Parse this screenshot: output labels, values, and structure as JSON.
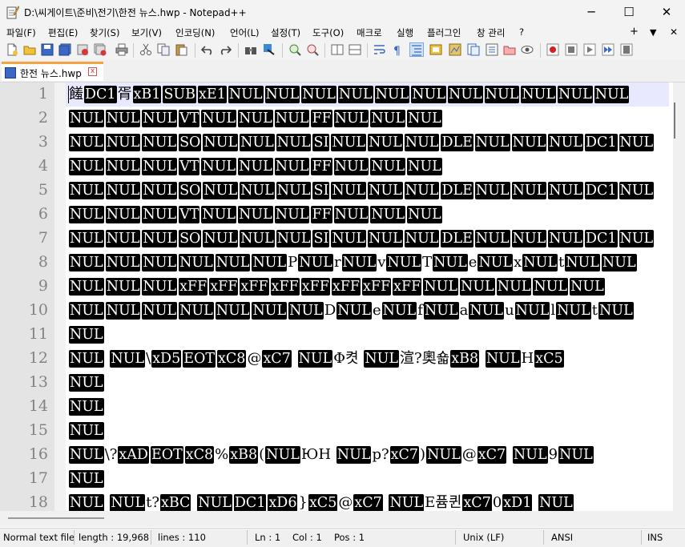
{
  "window": {
    "title": "D:\\씨게이트\\준비\\전기\\한전 뉴스.hwp - Notepad++",
    "minimize": "─",
    "maximize": "☐",
    "close": "✕"
  },
  "menu": {
    "items": [
      "파일(F)",
      "편집(E)",
      "찾기(S)",
      "보기(V)",
      "인코딩(N)",
      "언어(L)",
      "설정(T)",
      "도구(O)",
      "매크로",
      "실행",
      "플러그인",
      "창 관리",
      "?"
    ],
    "plus": "+",
    "down": "▼",
    "close": "✕"
  },
  "tab": {
    "label": "한전 뉴스.hwp",
    "close": "x"
  },
  "editor": {
    "line_numbers": [
      "1",
      "2",
      "3",
      "4",
      "5",
      "6",
      "7",
      "8",
      "9",
      "10",
      "11",
      "12",
      "13",
      "14",
      "15",
      "16",
      "17",
      "18"
    ],
    "lines": [
      [
        [
          "t",
          "饈"
        ],
        [
          "c",
          "DC1"
        ],
        [
          "t",
          "胥"
        ],
        [
          "c",
          "xB1"
        ],
        [
          "c",
          "SUB"
        ],
        [
          "c",
          "xE1"
        ],
        [
          "c",
          "NUL"
        ],
        [
          "c",
          "NUL"
        ],
        [
          "c",
          "NUL"
        ],
        [
          "c",
          "NUL"
        ],
        [
          "c",
          "NUL"
        ],
        [
          "c",
          "NUL"
        ],
        [
          "c",
          "NUL"
        ],
        [
          "c",
          "NUL"
        ],
        [
          "c",
          "NUL"
        ],
        [
          "c",
          "NUL"
        ],
        [
          "c",
          "NUL"
        ]
      ],
      [
        [
          "c",
          "NUL"
        ],
        [
          "c",
          "NUL"
        ],
        [
          "c",
          "NUL"
        ],
        [
          "c",
          "VT"
        ],
        [
          "c",
          "NUL"
        ],
        [
          "c",
          "NUL"
        ],
        [
          "c",
          "NUL"
        ],
        [
          "c",
          "FF"
        ],
        [
          "c",
          "NUL"
        ],
        [
          "c",
          "NUL"
        ],
        [
          "c",
          "NUL"
        ]
      ],
      [
        [
          "c",
          "NUL"
        ],
        [
          "c",
          "NUL"
        ],
        [
          "c",
          "NUL"
        ],
        [
          "c",
          "SO"
        ],
        [
          "c",
          "NUL"
        ],
        [
          "c",
          "NUL"
        ],
        [
          "c",
          "NUL"
        ],
        [
          "c",
          "SI"
        ],
        [
          "c",
          "NUL"
        ],
        [
          "c",
          "NUL"
        ],
        [
          "c",
          "NUL"
        ],
        [
          "c",
          "DLE"
        ],
        [
          "c",
          "NUL"
        ],
        [
          "c",
          "NUL"
        ],
        [
          "c",
          "NUL"
        ],
        [
          "c",
          "DC1"
        ],
        [
          "c",
          "NUL"
        ]
      ],
      [
        [
          "c",
          "NUL"
        ],
        [
          "c",
          "NUL"
        ],
        [
          "c",
          "NUL"
        ],
        [
          "c",
          "VT"
        ],
        [
          "c",
          "NUL"
        ],
        [
          "c",
          "NUL"
        ],
        [
          "c",
          "NUL"
        ],
        [
          "c",
          "FF"
        ],
        [
          "c",
          "NUL"
        ],
        [
          "c",
          "NUL"
        ],
        [
          "c",
          "NUL"
        ]
      ],
      [
        [
          "c",
          "NUL"
        ],
        [
          "c",
          "NUL"
        ],
        [
          "c",
          "NUL"
        ],
        [
          "c",
          "SO"
        ],
        [
          "c",
          "NUL"
        ],
        [
          "c",
          "NUL"
        ],
        [
          "c",
          "NUL"
        ],
        [
          "c",
          "SI"
        ],
        [
          "c",
          "NUL"
        ],
        [
          "c",
          "NUL"
        ],
        [
          "c",
          "NUL"
        ],
        [
          "c",
          "DLE"
        ],
        [
          "c",
          "NUL"
        ],
        [
          "c",
          "NUL"
        ],
        [
          "c",
          "NUL"
        ],
        [
          "c",
          "DC1"
        ],
        [
          "c",
          "NUL"
        ]
      ],
      [
        [
          "c",
          "NUL"
        ],
        [
          "c",
          "NUL"
        ],
        [
          "c",
          "NUL"
        ],
        [
          "c",
          "VT"
        ],
        [
          "c",
          "NUL"
        ],
        [
          "c",
          "NUL"
        ],
        [
          "c",
          "NUL"
        ],
        [
          "c",
          "FF"
        ],
        [
          "c",
          "NUL"
        ],
        [
          "c",
          "NUL"
        ],
        [
          "c",
          "NUL"
        ]
      ],
      [
        [
          "c",
          "NUL"
        ],
        [
          "c",
          "NUL"
        ],
        [
          "c",
          "NUL"
        ],
        [
          "c",
          "SO"
        ],
        [
          "c",
          "NUL"
        ],
        [
          "c",
          "NUL"
        ],
        [
          "c",
          "NUL"
        ],
        [
          "c",
          "SI"
        ],
        [
          "c",
          "NUL"
        ],
        [
          "c",
          "NUL"
        ],
        [
          "c",
          "NUL"
        ],
        [
          "c",
          "DLE"
        ],
        [
          "c",
          "NUL"
        ],
        [
          "c",
          "NUL"
        ],
        [
          "c",
          "NUL"
        ],
        [
          "c",
          "DC1"
        ],
        [
          "c",
          "NUL"
        ]
      ],
      [
        [
          "c",
          "NUL"
        ],
        [
          "c",
          "NUL"
        ],
        [
          "c",
          "NUL"
        ],
        [
          "c",
          "NUL"
        ],
        [
          "c",
          "NUL"
        ],
        [
          "c",
          "NUL"
        ],
        [
          "t",
          "P"
        ],
        [
          "c",
          "NUL"
        ],
        [
          "t",
          "r"
        ],
        [
          "c",
          "NUL"
        ],
        [
          "t",
          "v"
        ],
        [
          "c",
          "NUL"
        ],
        [
          "t",
          "T"
        ],
        [
          "c",
          "NUL"
        ],
        [
          "t",
          "e"
        ],
        [
          "c",
          "NUL"
        ],
        [
          "t",
          "x"
        ],
        [
          "c",
          "NUL"
        ],
        [
          "t",
          "t"
        ],
        [
          "c",
          "NUL"
        ],
        [
          "c",
          "NUL"
        ]
      ],
      [
        [
          "c",
          "NUL"
        ],
        [
          "c",
          "NUL"
        ],
        [
          "c",
          "NUL"
        ],
        [
          "c",
          "xFF"
        ],
        [
          "c",
          "xFF"
        ],
        [
          "c",
          "xFF"
        ],
        [
          "c",
          "xFF"
        ],
        [
          "c",
          "xFF"
        ],
        [
          "c",
          "xFF"
        ],
        [
          "c",
          "xFF"
        ],
        [
          "c",
          "xFF"
        ],
        [
          "c",
          "NUL"
        ],
        [
          "c",
          "NUL"
        ],
        [
          "c",
          "NUL"
        ],
        [
          "c",
          "NUL"
        ],
        [
          "c",
          "NUL"
        ]
      ],
      [
        [
          "c",
          "NUL"
        ],
        [
          "c",
          "NUL"
        ],
        [
          "c",
          "NUL"
        ],
        [
          "c",
          "NUL"
        ],
        [
          "c",
          "NUL"
        ],
        [
          "c",
          "NUL"
        ],
        [
          "c",
          "NUL"
        ],
        [
          "t",
          "D"
        ],
        [
          "c",
          "NUL"
        ],
        [
          "t",
          "e"
        ],
        [
          "c",
          "NUL"
        ],
        [
          "t",
          "f"
        ],
        [
          "c",
          "NUL"
        ],
        [
          "t",
          "a"
        ],
        [
          "c",
          "NUL"
        ],
        [
          "t",
          "u"
        ],
        [
          "c",
          "NUL"
        ],
        [
          "t",
          "l"
        ],
        [
          "c",
          "NUL"
        ],
        [
          "t",
          "t"
        ],
        [
          "c",
          "NUL"
        ]
      ],
      [
        [
          "c",
          "NUL"
        ]
      ],
      [
        [
          "c",
          "NUL"
        ],
        [
          "t",
          " "
        ],
        [
          "c",
          "NUL"
        ],
        [
          "t",
          "\\"
        ],
        [
          "c",
          "xD5"
        ],
        [
          "c",
          "EOT"
        ],
        [
          "c",
          "xC8"
        ],
        [
          "t",
          "@"
        ],
        [
          "c",
          "xC7"
        ],
        [
          "t",
          " "
        ],
        [
          "c",
          "NUL"
        ],
        [
          "t",
          "Φ켯 "
        ],
        [
          "c",
          "NUL"
        ],
        [
          "t",
          "渲?奧숇"
        ],
        [
          "c",
          "xB8"
        ],
        [
          "t",
          " "
        ],
        [
          "c",
          "NUL"
        ],
        [
          "t",
          "H"
        ],
        [
          "c",
          "xC5"
        ]
      ],
      [
        [
          "c",
          "NUL"
        ]
      ],
      [
        [
          "c",
          "NUL"
        ]
      ],
      [
        [
          "c",
          "NUL"
        ]
      ],
      [
        [
          "c",
          "NUL"
        ],
        [
          "t",
          "\\?"
        ],
        [
          "c",
          "xAD"
        ],
        [
          "c",
          "EOT"
        ],
        [
          "c",
          "xC8"
        ],
        [
          "t",
          "%"
        ],
        [
          "c",
          "xB8"
        ],
        [
          "t",
          "("
        ],
        [
          "c",
          "NUL"
        ],
        [
          "t",
          "ЮH "
        ],
        [
          "c",
          "NUL"
        ],
        [
          "t",
          "p?"
        ],
        [
          "c",
          "xC7"
        ],
        [
          "t",
          ")"
        ],
        [
          "c",
          "NUL"
        ],
        [
          "t",
          "@"
        ],
        [
          "c",
          "xC7"
        ],
        [
          "t",
          " "
        ],
        [
          "c",
          "NUL"
        ],
        [
          "t",
          "9"
        ],
        [
          "c",
          "NUL"
        ]
      ],
      [
        [
          "c",
          "NUL"
        ]
      ],
      [
        [
          "c",
          "NUL"
        ],
        [
          "t",
          " "
        ],
        [
          "c",
          "NUL"
        ],
        [
          "t",
          "t?"
        ],
        [
          "c",
          "xBC"
        ],
        [
          "t",
          " "
        ],
        [
          "c",
          "NUL"
        ],
        [
          "c",
          "DC1"
        ],
        [
          "c",
          "xD6"
        ],
        [
          "t",
          "}"
        ],
        [
          "c",
          "xC5"
        ],
        [
          "t",
          "@"
        ],
        [
          "c",
          "xC7"
        ],
        [
          "t",
          " "
        ],
        [
          "c",
          "NUL"
        ],
        [
          "t",
          "E퓸퀸"
        ],
        [
          "c",
          "xC7"
        ],
        [
          "t",
          "0"
        ],
        [
          "c",
          "xD1"
        ],
        [
          "t",
          " "
        ],
        [
          "c",
          "NUL"
        ]
      ]
    ]
  },
  "status": {
    "file_type": "Normal text file",
    "length": "length : 19,968",
    "lines": "lines : 110",
    "ln": "Ln : 1",
    "col": "Col : 1",
    "pos": "Pos : 1",
    "eol": "Unix (LF)",
    "encoding": "ANSI",
    "mode": "INS"
  },
  "colors": {
    "control_char_bg": "#000000",
    "control_char_fg": "#ffffff",
    "current_line": "#e8e8ff",
    "tab_accent": "#f4a340"
  }
}
